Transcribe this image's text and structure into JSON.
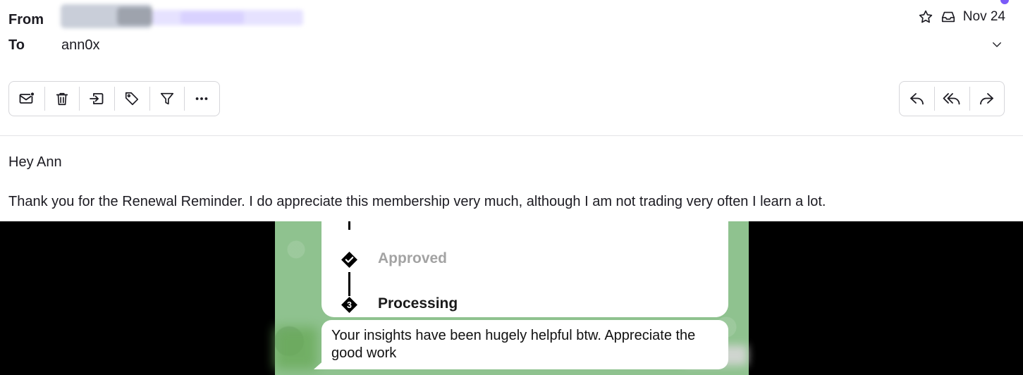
{
  "header": {
    "from_label": "From",
    "to_label": "To",
    "to_value": "ann0x",
    "date": "Nov 24"
  },
  "toolbar_left": {
    "icons": [
      "mark-unread-icon",
      "delete-icon",
      "move-to-icon",
      "tag-icon",
      "filter-icon",
      "more-icon"
    ]
  },
  "toolbar_right": {
    "icons": [
      "reply-icon",
      "reply-all-icon",
      "forward-icon"
    ]
  },
  "body": {
    "greeting": "Hey Ann",
    "paragraph": "Thank you for the Renewal Reminder. I do appreciate this membership very much, although I am not trading very often I learn a lot."
  },
  "image": {
    "steps": [
      {
        "label": "Approved",
        "marker": "check"
      },
      {
        "label": "Processing",
        "marker": "3"
      }
    ],
    "message": "Your insights have been hugely helpful btw. Appreciate the good work"
  },
  "colors": {
    "accent": "#7a5af8",
    "chat_background": "#8fc28f"
  }
}
